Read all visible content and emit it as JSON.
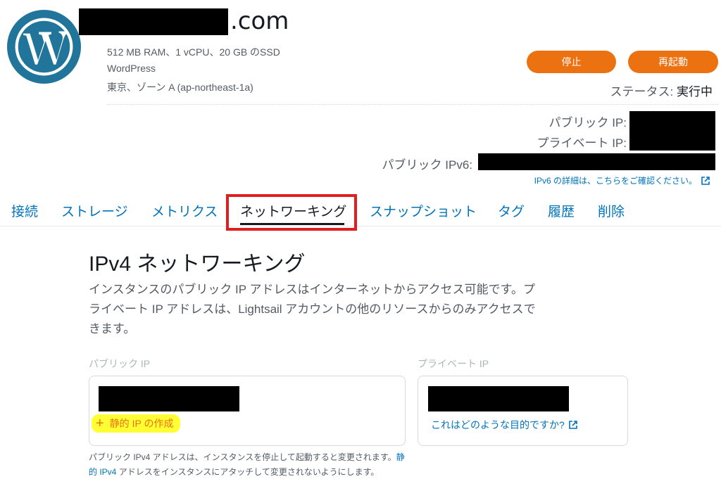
{
  "instance": {
    "domain_suffix": ".com",
    "specs": "512 MB RAM、1 vCPU、20 GB のSSD",
    "blueprint": "WordPress",
    "zone": "東京、ゾーン A (ap-northeast-1a)",
    "logo_icon": "wordpress-logo-icon"
  },
  "actions": {
    "stop_label": "停止",
    "reboot_label": "再起動"
  },
  "status": {
    "label": "ステータス: ",
    "value": "実行中"
  },
  "ips": {
    "public_label": "パブリック IP:",
    "private_label": "プライベート IP:",
    "ipv6_label": "パブリック IPv6:",
    "ipv6_help": "IPv6 の詳細は、こちらをご確認ください。"
  },
  "tabs": [
    {
      "label": "接続"
    },
    {
      "label": "ストレージ"
    },
    {
      "label": "メトリクス"
    },
    {
      "label": "ネットワーキング"
    },
    {
      "label": "スナップショット"
    },
    {
      "label": "タグ"
    },
    {
      "label": "履歴"
    },
    {
      "label": "削除"
    }
  ],
  "active_tab": "ネットワーキング",
  "networking": {
    "title": "IPv4 ネットワーキング",
    "description": "インスタンスのパブリック IP アドレスはインターネットからアクセス可能です。プライベート IP アドレスは、Lightsail アカウントの他のリソースからのみアクセスできます。",
    "public_col_label": "パブリック IP",
    "private_col_label": "プライベート IP",
    "create_static_ip": "静的 IP の作成",
    "purpose_link": "これはどのような目的ですか?",
    "note_part1": "パブリック IPv4 アドレスは、インスタンスを停止して起動すると変更されます。",
    "note_link": "静的 IPv4",
    "note_part2": " アドレスをインスタンスにアタッチして変更されないようにします。"
  },
  "colors": {
    "accent_orange": "#ec7211",
    "link_blue": "#0073bb",
    "wordpress_blue": "#21759b",
    "highlight_red": "#e01e1e",
    "highlight_yellow": "#ffff33"
  }
}
